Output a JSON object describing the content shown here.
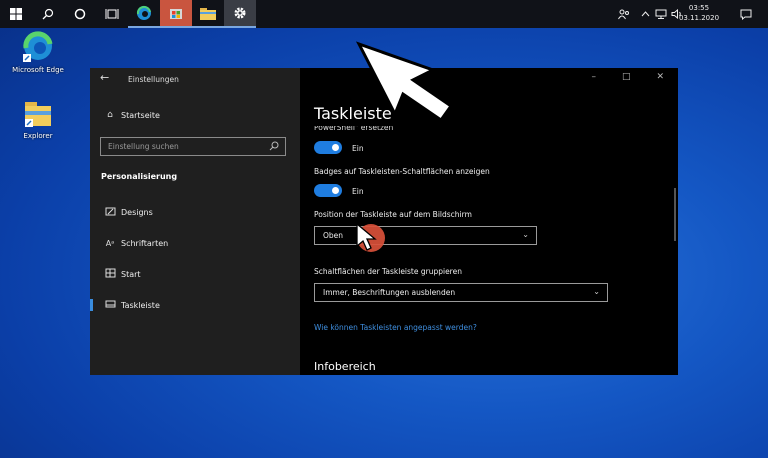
{
  "taskbar": {
    "icons": [
      "windows-logo",
      "search-icon",
      "cortana-icon",
      "task-view-icon",
      "edge-icon",
      "store-icon",
      "explorer-icon",
      "settings-icon"
    ],
    "clock": {
      "time": "03:55",
      "date": "03.11.2020"
    }
  },
  "desktop": {
    "icons": [
      {
        "label": "Microsoft Edge"
      },
      {
        "label": "Explorer"
      }
    ]
  },
  "window": {
    "title": "Einstellungen",
    "sidebar": {
      "home": "Startseite",
      "search_placeholder": "Einstellung suchen",
      "section": "Personalisierung",
      "items": [
        {
          "label": "Designs",
          "icon": "designs-icon"
        },
        {
          "label": "Schriftarten",
          "icon": "fonts-icon"
        },
        {
          "label": "Start",
          "icon": "start-icon"
        },
        {
          "label": "Taskleiste",
          "icon": "taskbar-icon",
          "selected": true
        }
      ]
    },
    "main": {
      "title": "Taskleiste",
      "cut_text": "PowerShell\" ersetzen",
      "toggle1_label": "Ein",
      "badges_label": "Badges auf Taskleisten-Schaltflächen anzeigen",
      "toggle2_label": "Ein",
      "position_label": "Position der Taskleiste auf dem Bildschirm",
      "position_value": "Oben",
      "group_label": "Schaltflächen der Taskleiste gruppieren",
      "group_value": "Immer, Beschriftungen ausblenden",
      "link": "Wie können Taskleisten angepasst werden?",
      "section2": "Infobereich"
    }
  },
  "colors": {
    "accent": "#1f7de0",
    "highlight": "#d9503a"
  }
}
